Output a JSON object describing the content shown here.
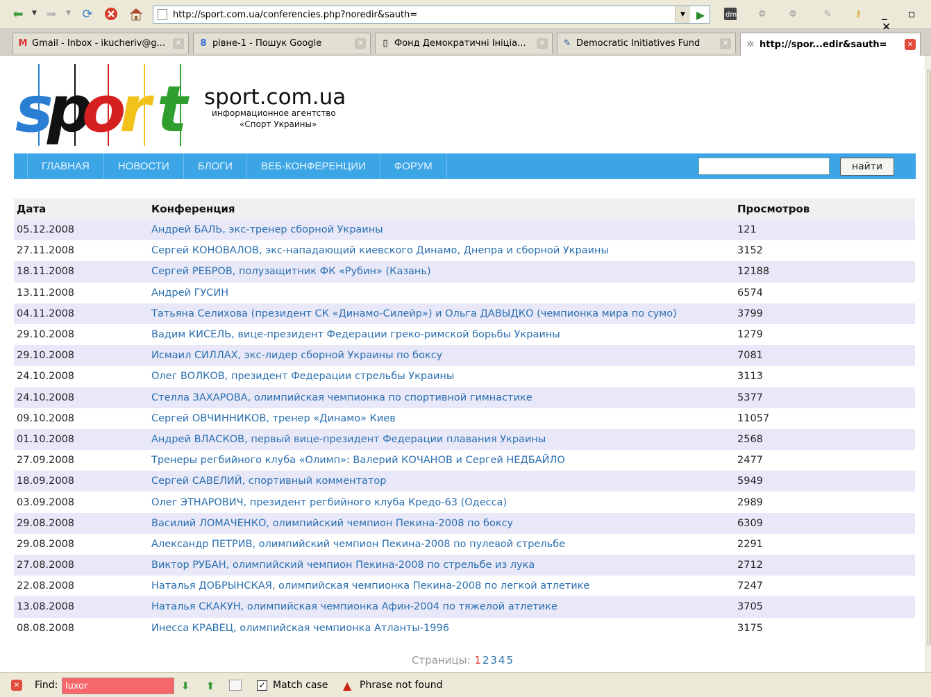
{
  "browser": {
    "url": "http://sport.com.ua/conferencies.php?noredir&sauth=",
    "tabs": [
      {
        "label": "Gmail - Inbox - ikucheriv@g...",
        "icon": "gmail-icon",
        "active": false
      },
      {
        "label": "рівне-1 - Пошук Google",
        "icon": "google-icon",
        "active": false
      },
      {
        "label": "Фонд Демократичні Ініціа...",
        "icon": "page-icon",
        "active": false
      },
      {
        "label": "Democratic Initiatives Fund",
        "icon": "pen-icon",
        "active": false
      },
      {
        "label": "http://spor...edir&sauth=",
        "icon": "loading-icon",
        "active": true
      }
    ]
  },
  "site": {
    "logo_letters": [
      "s",
      "p",
      "o",
      "r",
      "t"
    ],
    "logo_colors": [
      "#2a7fd4",
      "#111111",
      "#d62020",
      "#f2c21a",
      "#2e9e2e"
    ],
    "name": "sport.com.ua",
    "subtitle_line1": "информационное агентство",
    "subtitle_line2": "«Спорт Украины»"
  },
  "nav": {
    "items": [
      "ГЛАВНАЯ",
      "НОВОСТИ",
      "БЛОГИ",
      "ВЕБ-КОНФЕРЕНЦИИ",
      "ФОРУМ"
    ],
    "search_value": "",
    "search_button": "найти"
  },
  "table": {
    "headers": {
      "date": "Дата",
      "title": "Конференция",
      "views": "Просмотров"
    },
    "rows": [
      {
        "date": "05.12.2008",
        "title": "Андрей БАЛЬ, экс-тренер сборной Украины",
        "views": "121"
      },
      {
        "date": "27.11.2008",
        "title": "Сергей КОНОВАЛОВ, экс-нападающий киевского Динамо, Днепра и сборной Украины",
        "views": "3152"
      },
      {
        "date": "18.11.2008",
        "title": "Сергей РЕБРОВ, полузащитник ФК «Рубин» (Казань)",
        "views": "12188"
      },
      {
        "date": "13.11.2008",
        "title": "Андрей ГУСИН",
        "views": "6574"
      },
      {
        "date": "04.11.2008",
        "title": "Татьяна Селихова (президент СК «Динамо-Силейр») и Ольга ДАВЫДКО (чемпионка мира по сумо)",
        "views": "3799"
      },
      {
        "date": "29.10.2008",
        "title": "Вадим КИСЕЛЬ, вице-президент Федерации греко-римской борьбы Украины",
        "views": "1279"
      },
      {
        "date": "29.10.2008",
        "title": "Исмаил СИЛЛАХ, экс-лидер сборной Украины по боксу",
        "views": "7081"
      },
      {
        "date": "24.10.2008",
        "title": "Олег ВОЛКОВ, президент Федерации стрельбы Украины",
        "views": "3113"
      },
      {
        "date": "24.10.2008",
        "title": "Стелла ЗАХАРОВА, олимпийская чемпионка по спортивной гимнастике",
        "views": "5377"
      },
      {
        "date": "09.10.2008",
        "title": "Сергей ОВЧИННИКОВ, тренер «Динамо» Киев",
        "views": "11057"
      },
      {
        "date": "01.10.2008",
        "title": "Андрей ВЛАСКОВ, первый вице-президент Федерации плавания Украины",
        "views": "2568"
      },
      {
        "date": "27.09.2008",
        "title": "Тренеры регбийного клуба «Олимп»: Валерий КОЧАНОВ и Сергей НЕДБАЙЛО",
        "views": "2477"
      },
      {
        "date": "18.09.2008",
        "title": "Сергей САВЕЛИЙ, спортивный комментатор",
        "views": "5949"
      },
      {
        "date": "03.09.2008",
        "title": "Олег ЭТНАРОВИЧ, президент регбийного клуба Кредо-63 (Одесса)",
        "views": "2989"
      },
      {
        "date": "29.08.2008",
        "title": "Василий ЛОМАЧЕНКО, олимпийский чемпион Пекина-2008 по боксу",
        "views": "6309"
      },
      {
        "date": "29.08.2008",
        "title": "Александр ПЕТРИВ, олимпийский чемпион Пекина-2008 по пулевой стрельбе",
        "views": "2291"
      },
      {
        "date": "27.08.2008",
        "title": "Виктор РУБАН, олимпийский чемпион Пекина-2008 по стрельбе из лука",
        "views": "2712"
      },
      {
        "date": "22.08.2008",
        "title": "Наталья ДОБРЫНСКАЯ, олимпийская чемпионка Пекина-2008 по легкой атлетике",
        "views": "7247"
      },
      {
        "date": "13.08.2008",
        "title": "Наталья СКАКУН, олимпийская чемпионка Афин-2004 по тяжелой атлетике",
        "views": "3705"
      },
      {
        "date": "08.08.2008",
        "title": "Инесса КРАВЕЦ, олимпийская чемпионка Атланты-1996",
        "views": "3175"
      }
    ]
  },
  "pager": {
    "label": "Страницы:",
    "pages": [
      "1",
      "2",
      "3",
      "4",
      "5"
    ],
    "current": "1"
  },
  "findbar": {
    "label": "Find:",
    "value": "luxor",
    "match_case_label": "Match case",
    "match_case_checked": true,
    "status": "Phrase not found"
  }
}
